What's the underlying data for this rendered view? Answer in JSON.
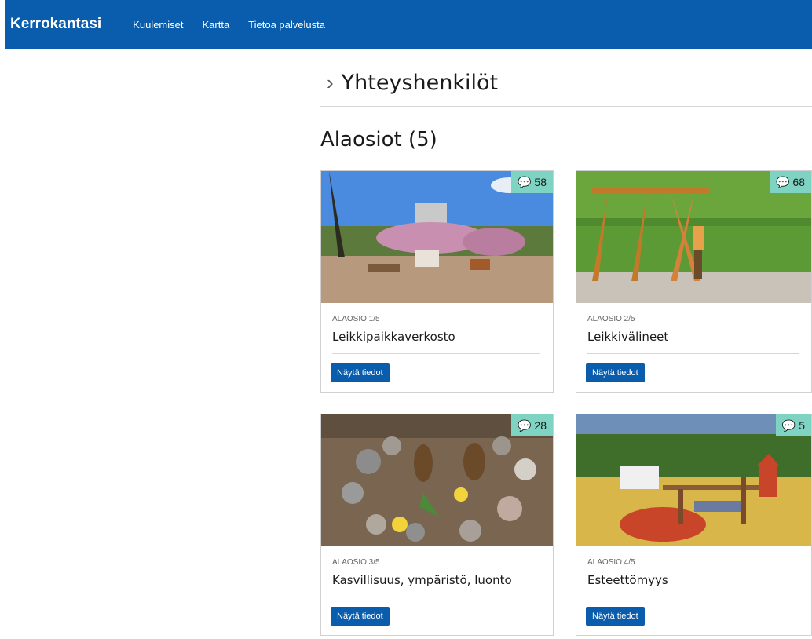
{
  "nav": {
    "brand": "Kerrokantasi",
    "links": [
      "Kuulemiset",
      "Kartta",
      "Tietoa palvelusta"
    ]
  },
  "section": {
    "title": "Yhteyshenkilöt"
  },
  "subsections": {
    "heading": "Alaosiot (5)",
    "cards": [
      {
        "number": "ALAOSIO 1/5",
        "title": "Leikkipaikkaverkosto",
        "comments": "58",
        "button": "Näytä tiedot"
      },
      {
        "number": "ALAOSIO 2/5",
        "title": "Leikkivälineet",
        "comments": "68",
        "button": "Näytä tiedot"
      },
      {
        "number": "ALAOSIO 3/5",
        "title": "Kasvillisuus, ympäristö, luonto",
        "comments": "28",
        "button": "Näytä tiedot"
      },
      {
        "number": "ALAOSIO 4/5",
        "title": "Esteettömyys",
        "comments": "5",
        "button": "Näytä tiedot"
      }
    ]
  },
  "colors": {
    "nav": "#0a5cac",
    "badge": "#7fd3c2",
    "button": "#0a5cac"
  }
}
